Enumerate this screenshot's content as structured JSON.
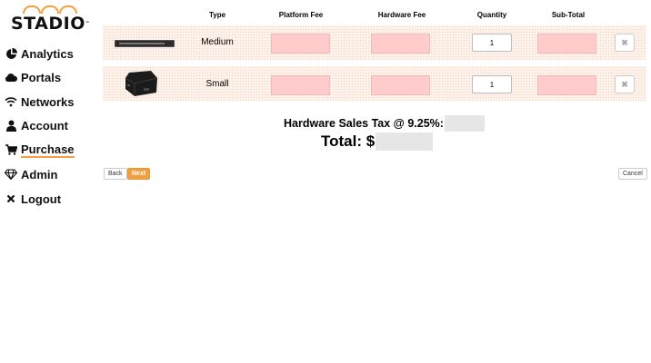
{
  "brand": {
    "name": "STADIO",
    "trademark": "™",
    "accent_color": "#f0a040"
  },
  "nav": {
    "items": [
      {
        "label": "Analytics",
        "icon": "pie-chart-icon"
      },
      {
        "label": "Portals",
        "icon": "cloud-icon"
      },
      {
        "label": "Networks",
        "icon": "wifi-icon"
      },
      {
        "label": "Account",
        "icon": "user-icon"
      },
      {
        "label": "Purchase",
        "icon": "cart-icon",
        "active": true
      },
      {
        "label": "Admin",
        "icon": "diamond-icon"
      },
      {
        "label": "Logout",
        "icon": "close-icon"
      }
    ]
  },
  "table": {
    "headers": [
      "Type",
      "Platform Fee",
      "Hardware Fee",
      "Quantity",
      "Sub-Total"
    ],
    "rows": [
      {
        "image": "rack-server-image",
        "type": "Medium",
        "quantity": "1",
        "remove_icon": "✖"
      },
      {
        "image": "small-device-image",
        "type": "Small",
        "quantity": "1",
        "remove_icon": "✖"
      }
    ],
    "row_color": "#fdf3ec",
    "fee_placeholder_color": "#ffcbcb"
  },
  "summary": {
    "tax_label": "Hardware Sales Tax @ 9.25%:",
    "total_label": "Total: $"
  },
  "buttons": {
    "back": "Back",
    "next": "Next",
    "cancel": "Cancel"
  }
}
